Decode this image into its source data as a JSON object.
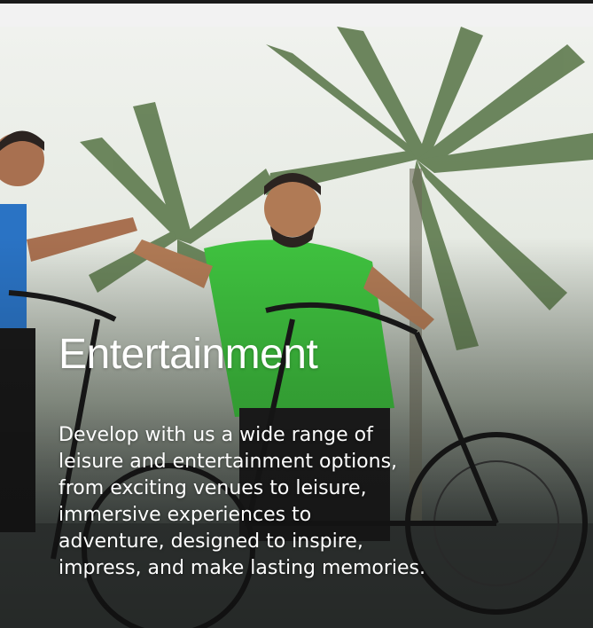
{
  "card": {
    "title": "Entertainment",
    "description_lines": [
      "Develop with us a wide range of",
      "leisure and entertainment options,",
      "from exciting venues to leisure,",
      "immersive experiences to",
      "adventure, designed to inspire,",
      "impress, and make lasting memories."
    ]
  },
  "colors": {
    "title_text": "#ffffff",
    "shirt_green": "#3fc23f",
    "shirt_blue": "#2a73c4",
    "foliage": "#5e7a4e"
  },
  "icons": [
    "palm-tree-illustration",
    "bicycle-icon"
  ]
}
